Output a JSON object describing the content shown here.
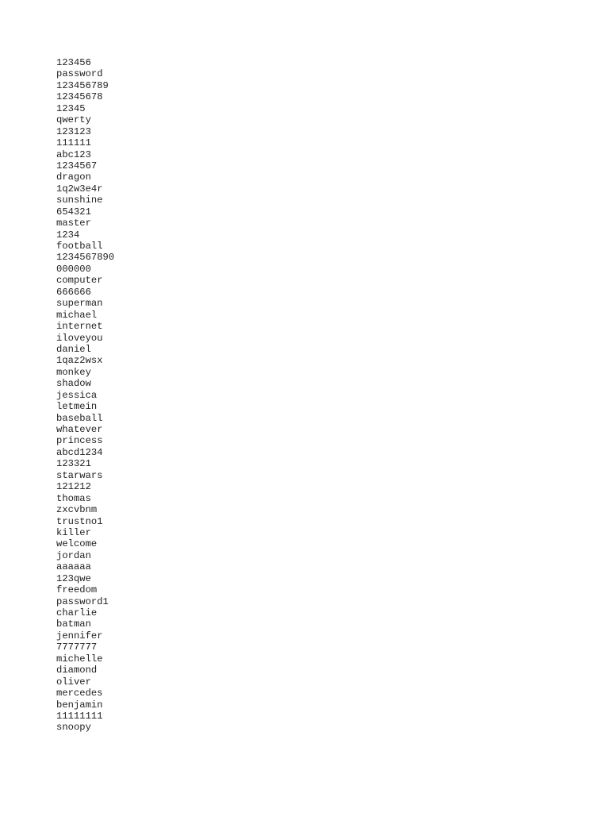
{
  "document": {
    "entries": [
      "123456",
      "password",
      "123456789",
      "12345678",
      "12345",
      "qwerty",
      "123123",
      "111111",
      "abc123",
      "1234567",
      "dragon",
      "1q2w3e4r",
      "sunshine",
      "654321",
      "master",
      "1234",
      "football",
      "1234567890",
      "000000",
      "computer",
      "666666",
      "superman",
      "michael",
      "internet",
      "iloveyou",
      "daniel",
      "1qaz2wsx",
      "monkey",
      "shadow",
      "jessica",
      "letmein",
      "baseball",
      "whatever",
      "princess",
      "abcd1234",
      "123321",
      "starwars",
      "121212",
      "thomas",
      "zxcvbnm",
      "trustno1",
      "killer",
      "welcome",
      "jordan",
      "aaaaaa",
      "123qwe",
      "freedom",
      "password1",
      "charlie",
      "batman",
      "jennifer",
      "7777777",
      "michelle",
      "diamond",
      "oliver",
      "mercedes",
      "benjamin",
      "11111111",
      "snoopy"
    ]
  }
}
